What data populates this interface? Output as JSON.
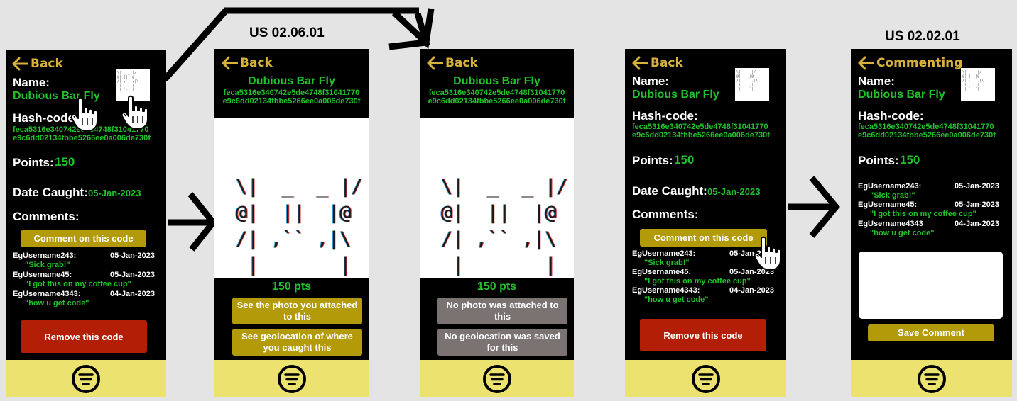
{
  "us_titles": [
    "US 02.06.01",
    "US 02.02.01"
  ],
  "colors": {
    "accent_green": "#22c12c",
    "nav_yellow": "#ebe26f",
    "button_gold": "#b39a08",
    "button_red": "#b31e06",
    "button_grey": "#7b7272",
    "back_gold": "#d6b23b"
  },
  "icons": [
    "back-arrow-icon",
    "menu-icon",
    "pointing-hand-icon",
    "flow-arrow-icon"
  ],
  "monster": {
    "name": "Dubious Bar Fly",
    "hash_line1": "feca5316e340742e5de4748f31041770",
    "hash_line2": "e9c6dd02134fbbe5266ee0a006de730f",
    "points": "150",
    "points_label": "150 pts",
    "date": "05-Jan-2023",
    "ascii": [
      "\\|  _  _ |/",
      "@|  ||  |@",
      "/| ,`` ,|\\",
      " |       |",
      " | `--` |"
    ],
    "thumb_ascii": "\\| _ _ |/\n@| || |@\n/| ,`` ,|\\\n |     |\n | `--`|"
  },
  "labels": {
    "back": "Back",
    "commenting": "Commenting",
    "name": "Name:",
    "hash": "Hash-code:",
    "points": "Points:",
    "date_caught": "Date Caught:",
    "comments": "Comments:",
    "comment_button": "Comment on this code",
    "remove_button": "Remove this code",
    "see_photo": "See the photo you attached to this",
    "see_geo": "See geolocation of where you caught this",
    "no_photo": "No photo was attached to this",
    "no_geo": "No geolocation was saved for this",
    "save_comment": "Save Comment"
  },
  "comments": [
    {
      "user": "EgUsername243:",
      "date": "05-Jan-2023",
      "text": "\"Sick grab!\""
    },
    {
      "user": "EgUsername45:",
      "date": "05-Jan-2023",
      "text": "\"I got this on my coffee cup\""
    },
    {
      "user": "EgUsername4343:",
      "date": "04-Jan-2023",
      "text": "\"how u get code\""
    }
  ],
  "comments_nocolon": [
    {
      "user": "EgUsername243:",
      "date": "05-Jan-2023",
      "text": "\"Sick grab!\""
    },
    {
      "user": "EgUsername45:",
      "date": "05-Jan-2023",
      "text": "\"I got this on my coffee cup\""
    },
    {
      "user": "EgUsername4343",
      "date": "04-Jan-2023",
      "text": "\"how u get code\""
    }
  ]
}
